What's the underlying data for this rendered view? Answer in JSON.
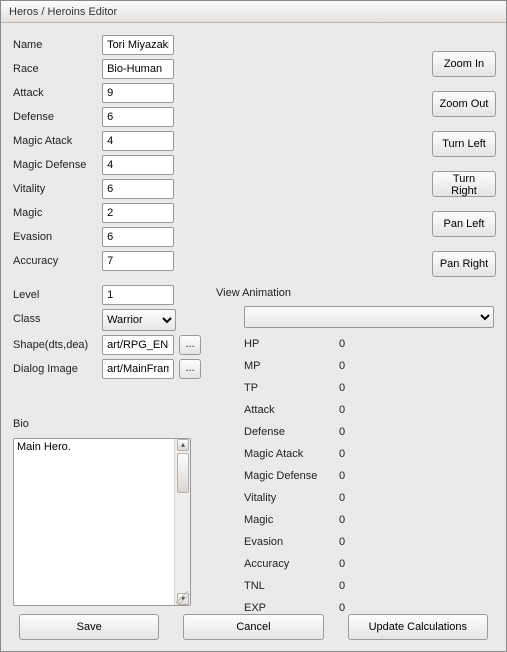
{
  "window_title": "Heros / Heroins Editor",
  "fields": {
    "name": {
      "label": "Name",
      "value": "Tori Miyazaki"
    },
    "race": {
      "label": "Race",
      "value": "Bio-Human"
    },
    "attack": {
      "label": "Attack",
      "value": "9"
    },
    "defense": {
      "label": "Defense",
      "value": "6"
    },
    "magic_attack": {
      "label": "Magic Atack",
      "value": "4"
    },
    "magic_defense": {
      "label": "Magic Defense",
      "value": "4"
    },
    "vitality": {
      "label": "Vitality",
      "value": "6"
    },
    "magic": {
      "label": "Magic",
      "value": "2"
    },
    "evasion": {
      "label": "Evasion",
      "value": "6"
    },
    "accuracy": {
      "label": "Accuracy",
      "value": "7"
    },
    "level": {
      "label": "Level",
      "value": "1"
    },
    "class": {
      "label": "Class",
      "value": "Warrior"
    },
    "shape": {
      "label": "Shape(dts,dea)",
      "value": "art/RPG_ENGIN"
    },
    "dialog_image": {
      "label": "Dialog Image",
      "value": "art/MainFrame/M"
    },
    "bio_label": "Bio",
    "bio_value": "Main Hero."
  },
  "side_buttons": {
    "zoom_in": "Zoom In",
    "zoom_out": "Zoom Out",
    "turn_left": "Turn Left",
    "turn_right": "Turn Right",
    "pan_left": "Pan Left",
    "pan_right": "Pan Right"
  },
  "view_animation": {
    "label": "View Animation",
    "selected": ""
  },
  "calc_stats": [
    {
      "label": "HP",
      "value": "0"
    },
    {
      "label": "MP",
      "value": "0"
    },
    {
      "label": "TP",
      "value": "0"
    },
    {
      "label": "Attack",
      "value": "0"
    },
    {
      "label": "Defense",
      "value": "0"
    },
    {
      "label": "Magic Atack",
      "value": "0"
    },
    {
      "label": "Magic Defense",
      "value": "0"
    },
    {
      "label": "Vitality",
      "value": "0"
    },
    {
      "label": "Magic",
      "value": "0"
    },
    {
      "label": "Evasion",
      "value": "0"
    },
    {
      "label": "Accuracy",
      "value": "0"
    },
    {
      "label": "TNL",
      "value": "0"
    },
    {
      "label": "EXP",
      "value": "0"
    }
  ],
  "footer": {
    "save": "Save",
    "cancel": "Cancel",
    "update": "Update Calculations"
  },
  "browse_glyph": "..."
}
